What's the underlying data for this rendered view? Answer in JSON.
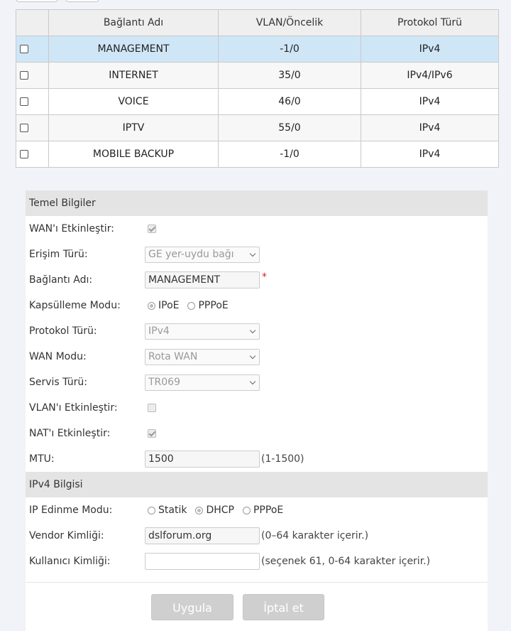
{
  "table": {
    "headers": [
      "",
      "Bağlantı Adı",
      "VLAN/Öncelik",
      "Protokol Türü"
    ],
    "rows": [
      {
        "name": "MANAGEMENT",
        "vlan": "-1/0",
        "protocol": "IPv4"
      },
      {
        "name": "INTERNET",
        "vlan": "35/0",
        "protocol": "IPv4/IPv6"
      },
      {
        "name": "VOICE",
        "vlan": "46/0",
        "protocol": "IPv4"
      },
      {
        "name": "IPTV",
        "vlan": "55/0",
        "protocol": "IPv4"
      },
      {
        "name": "MOBILE BACKUP",
        "vlan": "-1/0",
        "protocol": "IPv4"
      }
    ]
  },
  "basic": {
    "title": "Temel Bilgiler",
    "wan_enable_label": "WAN'ı Etkinleştir:",
    "access_type_label": "Erişim Türü:",
    "access_type_value": "GE yer-uydu bağı",
    "conn_name_label": "Bağlantı Adı:",
    "conn_name_value": "MANAGEMENT",
    "required_mark": "*",
    "encap_label": "Kapsülleme Modu:",
    "encap_opt1": "IPoE",
    "encap_opt2": "PPPoE",
    "protocol_label": "Protokol Türü:",
    "protocol_value": "IPv4",
    "wan_mode_label": "WAN Modu:",
    "wan_mode_value": "Rota WAN",
    "service_label": "Servis Türü:",
    "service_value": "TR069",
    "vlan_enable_label": "VLAN'ı Etkinleştir:",
    "nat_enable_label": "NAT'ı Etkinleştir:",
    "mtu_label": "MTU:",
    "mtu_value": "1500",
    "mtu_hint": "(1-1500)"
  },
  "ipv4": {
    "title": "IPv4 Bilgisi",
    "ip_mode_label": "IP Edinme Modu:",
    "ip_opt1": "Statik",
    "ip_opt2": "DHCP",
    "ip_opt3": "PPPoE",
    "vendor_label": "Vendor Kimliği:",
    "vendor_value": "dslforum.org",
    "vendor_hint": "(0–64 karakter içerir.)",
    "user_label": "Kullanıcı Kimliği:",
    "user_value": "",
    "user_hint": "(seçenek 61, 0-64 karakter içerir.)"
  },
  "buttons": {
    "apply": "Uygula",
    "cancel": "İptal et"
  },
  "colors": {
    "selected_row": "#cfe6f7",
    "section_header": "#e4e4e4",
    "required": "#e02020",
    "disabled_button": "#cfcfcf"
  }
}
